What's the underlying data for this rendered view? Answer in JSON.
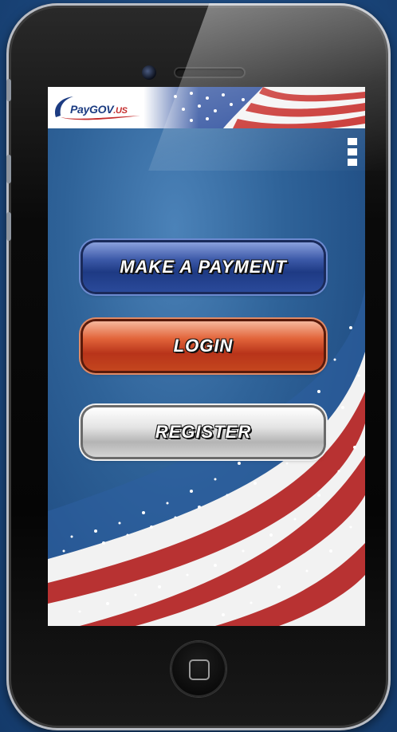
{
  "app": {
    "logo_text": "PayGOV",
    "logo_suffix": ".US"
  },
  "menu": {
    "icon": "overflow-menu-icon"
  },
  "buttons": {
    "make_payment": "MAKE A PAYMENT",
    "login": "LOGIN",
    "register": "REGISTER"
  },
  "colors": {
    "blue_button": "#2a4a9a",
    "red_button": "#c4461e",
    "silver_button": "#d4d4d4",
    "brand_blue": "#1c3c82",
    "brand_red": "#c42a2a"
  }
}
